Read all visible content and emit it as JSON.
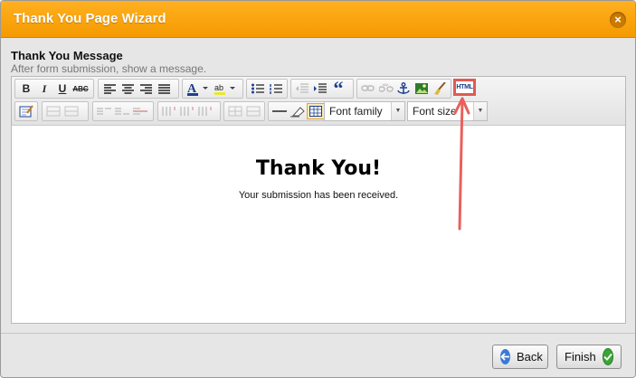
{
  "window": {
    "title": "Thank You Page Wizard",
    "close_glyph": "×"
  },
  "section": {
    "title": "Thank You Message",
    "subtitle": "After form submission, show a message."
  },
  "toolbar": {
    "bold": "B",
    "italic": "I",
    "underline": "U",
    "strike": "ABC",
    "quote": "“",
    "html_button": "HTML",
    "font_family": "Font family",
    "font_size": "Font size",
    "dropdown_arrow": "▼"
  },
  "editor": {
    "heading": "Thank You!",
    "message": "Your submission has been received."
  },
  "footer": {
    "back_label": "Back",
    "finish_label": "Finish"
  },
  "colors": {
    "titlebar": "#f9a40c",
    "highlight": "#e05a55",
    "finish_icon": "#3aa537",
    "back_icon": "#3a7bd5"
  },
  "icons": [
    "align-left-icon",
    "align-center-icon",
    "align-right-icon",
    "justify-icon",
    "font-color-icon",
    "highlight-icon",
    "bullet-list-icon",
    "numbered-list-icon",
    "outdent-icon",
    "indent-icon",
    "blockquote-icon",
    "link-icon",
    "unlink-icon",
    "anchor-icon",
    "image-icon",
    "cleanup-icon",
    "html-icon"
  ]
}
